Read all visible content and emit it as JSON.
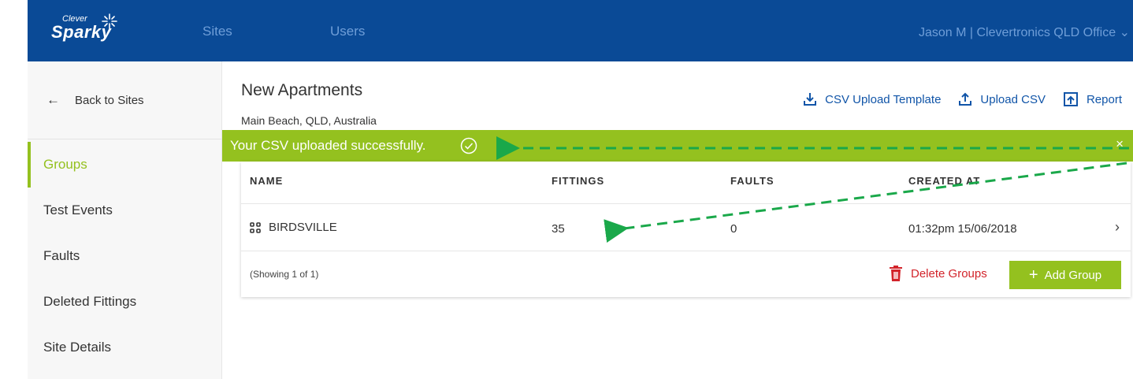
{
  "brand": {
    "top_word": "Clever",
    "main_word": "Sparky"
  },
  "nav": {
    "sites_label": "Sites",
    "users_label": "Users"
  },
  "user_menu": {
    "label": "Jason M | Clevertronics QLD Office",
    "caret": "⌄"
  },
  "sidebar": {
    "back_arrow": "←",
    "back_label": "Back to Sites",
    "items": [
      {
        "label": "Groups",
        "active": true
      },
      {
        "label": "Test Events",
        "active": false
      },
      {
        "label": "Faults",
        "active": false
      },
      {
        "label": "Deleted Fittings",
        "active": false
      },
      {
        "label": "Site Details",
        "active": false
      }
    ]
  },
  "site": {
    "title": "New Apartments",
    "address": "Main Beach, QLD, Australia"
  },
  "actions": {
    "csv_template_label": "CSV Upload Template",
    "upload_csv_label": "Upload CSV",
    "report_label": "Report"
  },
  "banner": {
    "message": "Your CSV uploaded successfully.",
    "close": "×"
  },
  "table": {
    "headers": {
      "name": "NAME",
      "fittings": "FITTINGS",
      "faults": "FAULTS",
      "created_at": "CREATED AT"
    },
    "rows": [
      {
        "name": "BIRDSVILLE",
        "fittings": "35",
        "faults": "0",
        "created_at": "01:32pm 15/06/2018",
        "chevron": "›"
      }
    ],
    "showing": "(Showing 1 of 1)"
  },
  "buttons": {
    "delete_groups": "Delete Groups",
    "add_group": "Add Group",
    "add_plus": "+"
  },
  "colors": {
    "nav_bg": "#0a4a96",
    "accent_green": "#94c11f",
    "link_blue": "#1155a8",
    "danger_red": "#d2232a",
    "annotation_green": "#1aa84a"
  }
}
